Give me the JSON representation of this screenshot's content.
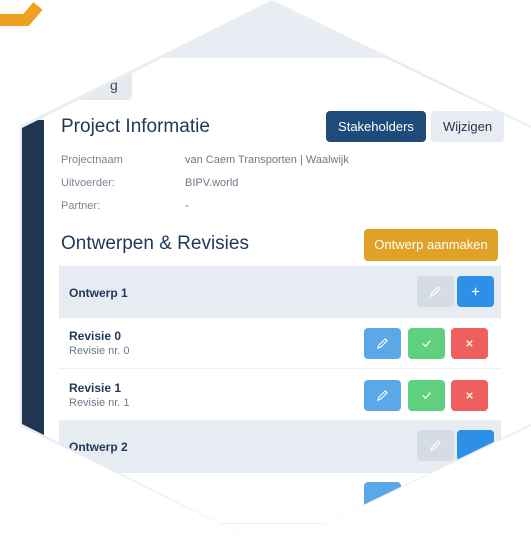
{
  "prev_button": {
    "label": "g"
  },
  "project": {
    "title": "Project Informatie",
    "stakeholders_label": "Stakeholders",
    "edit_label": "Wijzigen",
    "fields": [
      {
        "label": "Projectnaam",
        "value": "van Caem Transporten | Waalwijk"
      },
      {
        "label": "Uitvoerder:",
        "value": "BIPV.world"
      },
      {
        "label": "Partner:",
        "value": "-"
      }
    ]
  },
  "designs": {
    "title": "Ontwerpen & Revisies",
    "create_label": "Ontwerp aanmaken",
    "items": [
      {
        "name": "Ontwerp 1",
        "revisions": [
          {
            "name": "Revisie 0",
            "sub": "Revisie nr. 0"
          },
          {
            "name": "Revisie 1",
            "sub": "Revisie nr. 1"
          }
        ]
      },
      {
        "name": "Ontwerp 2"
      }
    ]
  },
  "colors": {
    "navy": "#1f4b7a",
    "orange": "#e0a127",
    "edit_blue": "#5ba8e8",
    "approve_green": "#5fcf80",
    "reject_red": "#ef5f5f",
    "add_blue": "#2e8fe8"
  },
  "icons": {
    "edit": "pencil-icon",
    "approve": "check-icon",
    "reject": "x-icon",
    "add": "plus-icon"
  }
}
